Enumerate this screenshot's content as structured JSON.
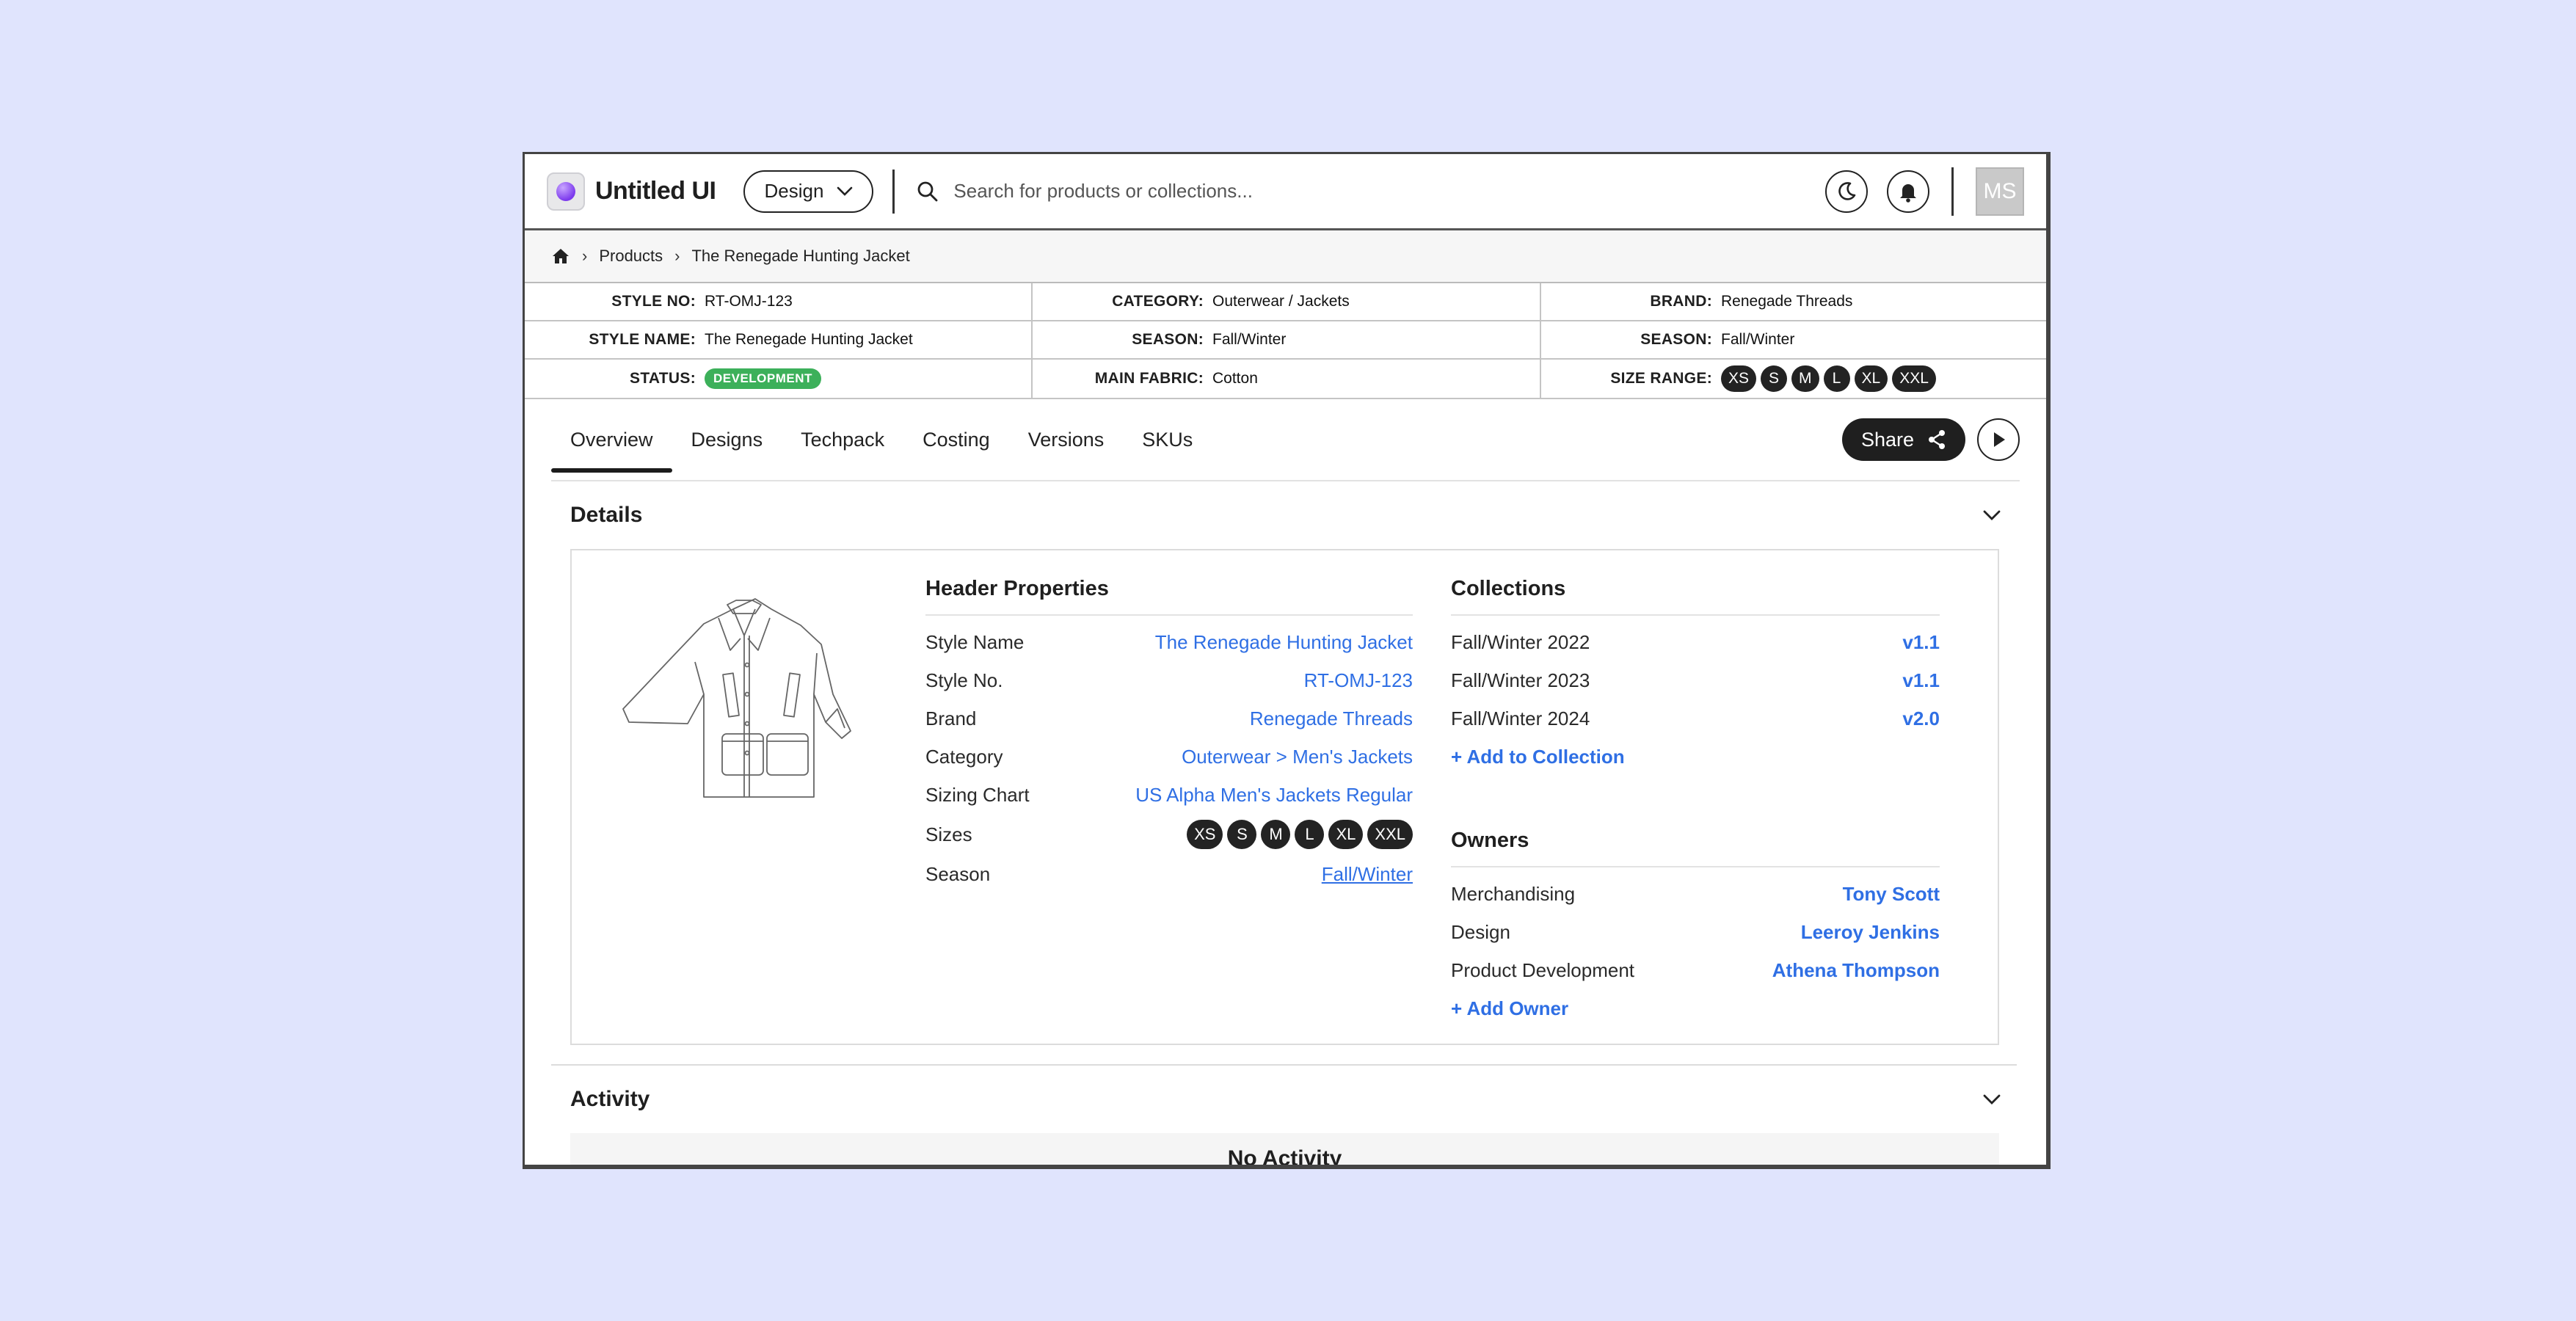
{
  "app": {
    "title": "Untitled UI"
  },
  "topbar": {
    "mode_label": "Design",
    "search_placeholder": "Search for products or collections...",
    "avatar_initials": "MS"
  },
  "breadcrumb": {
    "items": [
      "Products",
      "The Renegade Hunting Jacket"
    ]
  },
  "attributes": {
    "style_no_label": "STYLE NO:",
    "style_no": "RT-OMJ-123",
    "category_label": "CATEGORY:",
    "category": "Outerwear / Jackets",
    "brand_label": "BRAND:",
    "brand": "Renegade Threads",
    "style_name_label": "STYLE NAME:",
    "style_name": "The Renegade Hunting Jacket",
    "season_label": "SEASON:",
    "season": "Fall/Winter",
    "season2_label": "SEASON:",
    "season2": "Fall/Winter",
    "status_label": "STATUS:",
    "status": "DEVELOPMENT",
    "main_fabric_label": "MAIN FABRIC:",
    "main_fabric": "Cotton",
    "size_range_label": "SIZE RANGE:",
    "sizes": [
      "XS",
      "S",
      "M",
      "L",
      "XL",
      "XXL"
    ]
  },
  "tabs": [
    "Overview",
    "Designs",
    "Techpack",
    "Costing",
    "Versions",
    "SKUs"
  ],
  "actions": {
    "share_label": "Share"
  },
  "details": {
    "title": "Details",
    "header_properties": {
      "title": "Header Properties",
      "rows": [
        {
          "label": "Style Name",
          "value": "The Renegade Hunting Jacket"
        },
        {
          "label": "Style No.",
          "value": "RT-OMJ-123"
        },
        {
          "label": "Brand",
          "value": "Renegade Threads"
        },
        {
          "label": "Category",
          "value": "Outerwear > Men's Jackets"
        },
        {
          "label": "Sizing Chart",
          "value": "US Alpha Men's Jackets Regular"
        }
      ],
      "sizes_label": "Sizes",
      "sizes": [
        "XS",
        "S",
        "M",
        "L",
        "XL",
        "XXL"
      ],
      "season_label": "Season",
      "season_value": "Fall/Winter"
    },
    "collections": {
      "title": "Collections",
      "rows": [
        {
          "label": "Fall/Winter 2022",
          "value": "v1.1"
        },
        {
          "label": "Fall/Winter 2023",
          "value": "v1.1"
        },
        {
          "label": "Fall/Winter 2024",
          "value": "v2.0"
        }
      ],
      "add_label": "+ Add to Collection"
    },
    "owners": {
      "title": "Owners",
      "rows": [
        {
          "label": "Merchandising",
          "value": "Tony Scott"
        },
        {
          "label": "Design",
          "value": "Leeroy Jenkins"
        },
        {
          "label": "Product Development",
          "value": "Athena Thompson"
        }
      ],
      "add_label": "+ Add Owner"
    }
  },
  "activity": {
    "title": "Activity",
    "empty_text": "No Activity"
  }
}
